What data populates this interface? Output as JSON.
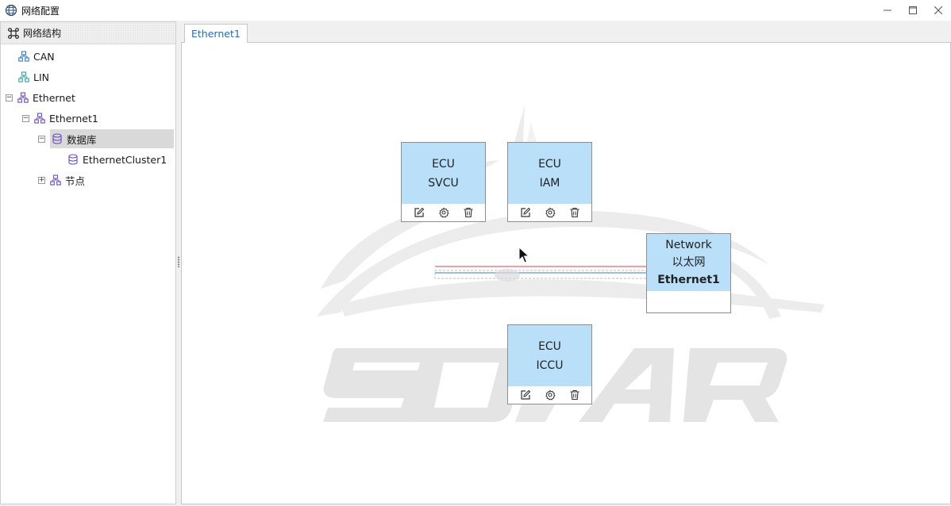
{
  "window": {
    "title": "网络配置",
    "controls": [
      "minimize-icon",
      "maximize-icon",
      "close-icon"
    ]
  },
  "left_panel": {
    "header": "网络结构",
    "tree": [
      {
        "label": "CAN",
        "icon": "network-icon",
        "expanded": null
      },
      {
        "label": "LIN",
        "icon": "network-icon",
        "expanded": null
      },
      {
        "label": "Ethernet",
        "icon": "network-icon",
        "expanded": true
      },
      {
        "label": "Ethernet1",
        "icon": "network-icon",
        "expanded": true
      },
      {
        "label": "数据库",
        "icon": "database-icon",
        "expanded": true,
        "selected": true
      },
      {
        "label": "EthernetCluster1",
        "icon": "database-icon",
        "expanded": null
      },
      {
        "label": "节点",
        "icon": "network-icon",
        "expanded": false
      }
    ]
  },
  "tabs": [
    {
      "label": "Ethernet1",
      "active": true
    }
  ],
  "diagram": {
    "watermark_text": "SOAR",
    "nodes": [
      {
        "type": "ECU",
        "name": "SVCU",
        "actions": [
          "edit-icon",
          "settings-icon",
          "delete-icon"
        ]
      },
      {
        "type": "ECU",
        "name": "IAM",
        "actions": [
          "edit-icon",
          "settings-icon",
          "delete-icon"
        ]
      },
      {
        "type": "ECU",
        "name": "ICCU",
        "actions": [
          "edit-icon",
          "settings-icon",
          "delete-icon"
        ]
      }
    ],
    "network": {
      "type": "Network",
      "subtitle": "以太网",
      "name": "Ethernet1"
    },
    "colors": {
      "node_fill": "#b9e0f8",
      "connector_red": "#f08080",
      "connector_blue": "#7aa7d9",
      "tab_text": "#1a6fc1"
    }
  }
}
